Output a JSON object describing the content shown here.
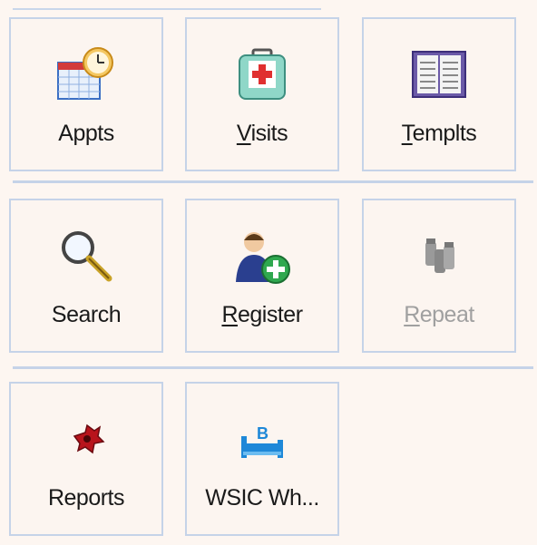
{
  "tiles": {
    "appts": {
      "label": "Appts",
      "icon": "calendar-clock-icon"
    },
    "visits": {
      "label_pre": "",
      "label_mnemonic": "V",
      "label_post": "isits",
      "icon": "first-aid-kit-icon"
    },
    "templts": {
      "label_pre": "",
      "label_mnemonic": "T",
      "label_post": "emplts",
      "icon": "book-icon"
    },
    "search": {
      "label": "Search",
      "icon": "magnifier-icon"
    },
    "register": {
      "label_pre": "",
      "label_mnemonic": "R",
      "label_post": "egister",
      "icon": "person-add-icon"
    },
    "repeat": {
      "label_pre": "",
      "label_mnemonic": "R",
      "label_post": "epeat",
      "icon": "repeat-icon",
      "disabled": true
    },
    "reports": {
      "label": "Reports",
      "icon": "reports-icon"
    },
    "wsic": {
      "label": "WSIC Wh...",
      "icon": "bed-icon"
    }
  },
  "colors": {
    "background": "#fdf6f1",
    "tile_border": "#c5d3e8",
    "text": "#1a1a1a",
    "disabled_text": "#a0a0a0"
  }
}
